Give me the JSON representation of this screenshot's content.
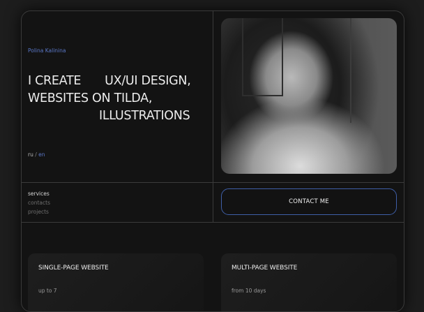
{
  "hero": {
    "author": "Polina Kalinina",
    "headline_line1_a": "I CREATE",
    "headline_line1_b": "UX/UI DESIGN,",
    "headline_line2": "WEBSITES ON TILDA,",
    "headline_line3": "ILLUSTRATIONS"
  },
  "language": {
    "ru": "ru",
    "separator": "/",
    "en": "en",
    "active": "en"
  },
  "nav": {
    "services": "services",
    "contacts": "contacts",
    "projects": "projects"
  },
  "cta": {
    "contact_label": "CONTACT ME"
  },
  "services": [
    {
      "title": "SINGLE-PAGE WEBSITE",
      "meta": "up to 7"
    },
    {
      "title": "MULTI-PAGE WEBSITE",
      "meta": "from 10 days"
    }
  ],
  "colors": {
    "accent": "#5b78c8",
    "button_border": "#3f5fa8",
    "background": "#131313"
  }
}
